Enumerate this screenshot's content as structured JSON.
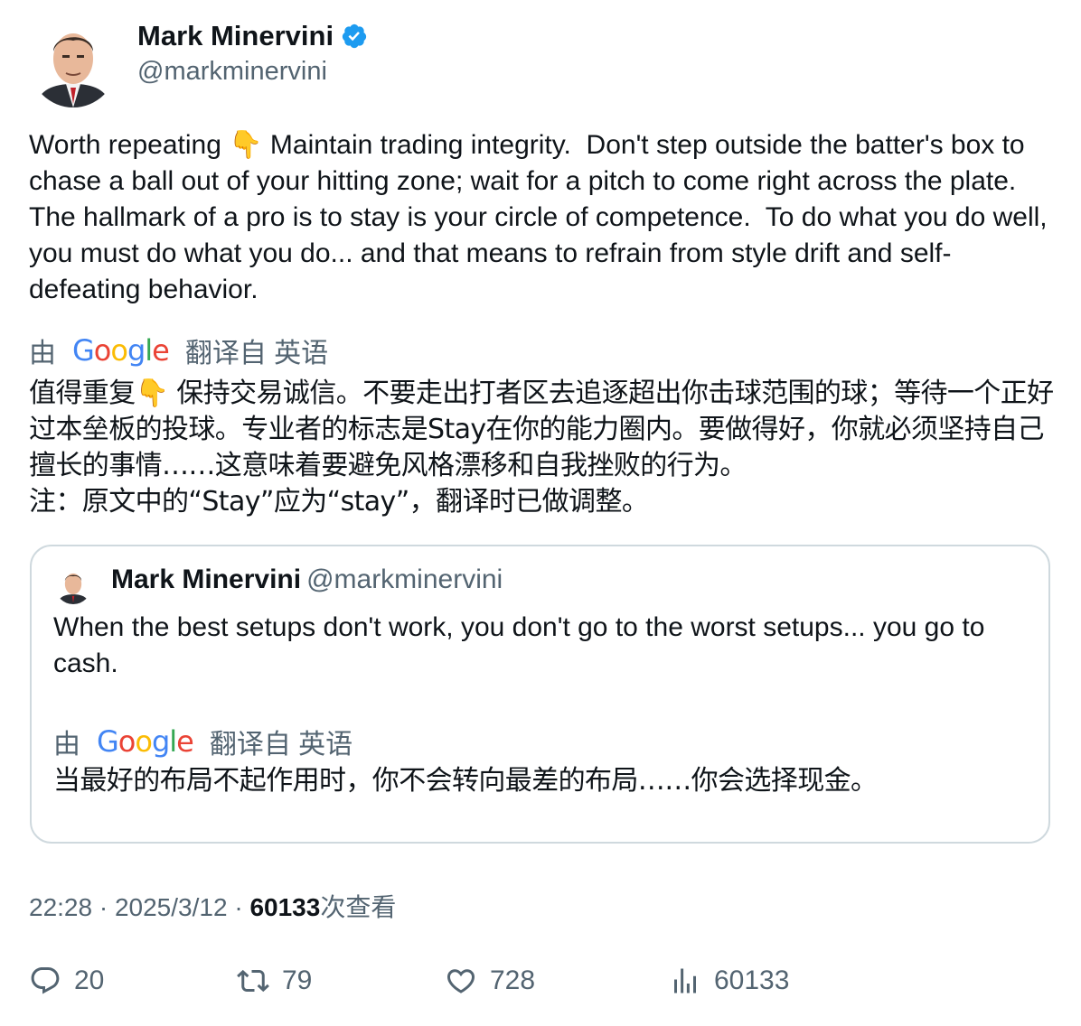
{
  "author": {
    "name": "Mark Minervini",
    "handle": "@markminervini",
    "verified_color": "#1d9bf0"
  },
  "tweet": {
    "text": "Worth repeating 👇 Maintain trading integrity.  Don't step outside the batter's box to chase a ball out of your hitting zone; wait for a pitch to come right across the plate. The hallmark of a pro is to stay is your circle of competence.  To do what you do well, you must do what you do... and that means to refrain from style drift and self-defeating behavior.",
    "translation": {
      "by_prefix": "由",
      "provider": "Google",
      "suffix": "翻译自 英语",
      "text": "值得重复👇 保持交易诚信。不要走出打者区去追逐超出你击球范围的球；等待一个正好过本垒板的投球。专业者的标志是Stay在你的能力圈内。要做得好，你就必须坚持自己擅长的事情……这意味着要避免风格漂移和自我挫败的行为。\n注：原文中的“Stay”应为“stay”，翻译时已做调整。"
    }
  },
  "quoted_tweet": {
    "name": "Mark Minervini",
    "handle": "@markminervini",
    "text": "When the best setups don't work, you don't go to the worst setups... you go to cash.",
    "translation": {
      "by_prefix": "由",
      "provider": "Google",
      "suffix": "翻译自 英语",
      "text": "当最好的布局不起作用时，你不会转向最差的布局……你会选择现金。"
    }
  },
  "meta": {
    "time": "22:28",
    "sep": "·",
    "date": "2025/3/12",
    "views_count": "60133",
    "views_label": "次查看"
  },
  "actions": {
    "replies": "20",
    "retweets": "79",
    "likes": "728",
    "views": "60133"
  }
}
